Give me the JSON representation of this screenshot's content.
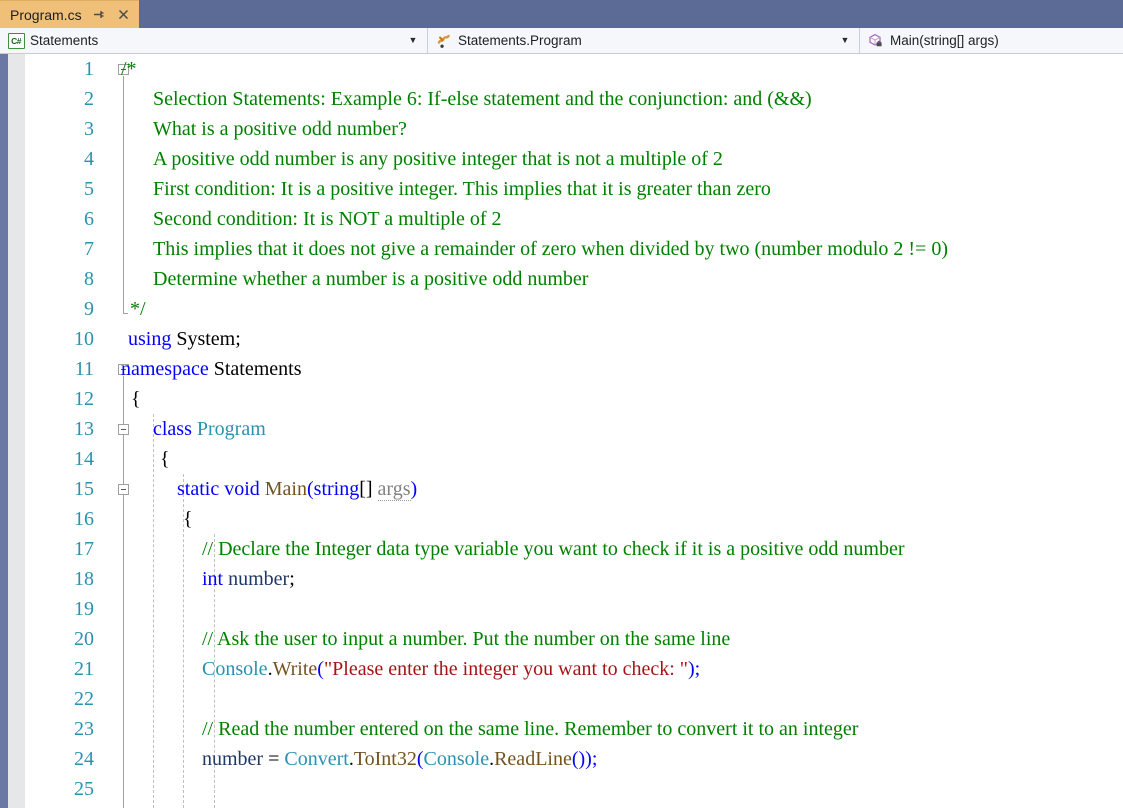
{
  "window": {
    "tab": {
      "title": "Program.cs",
      "pin_icon": "pin-icon",
      "close_icon": "close-icon"
    }
  },
  "navbar": {
    "project_combo": {
      "icon": "csharp-project-icon",
      "value": "Statements",
      "arrow": "chevron-down-icon"
    },
    "type_combo": {
      "icon": "class-icon",
      "value": "Statements.Program",
      "arrow": "chevron-down-icon"
    },
    "member_combo": {
      "icon": "method-private-icon",
      "value": "Main(string[] args)",
      "arrow": ""
    }
  },
  "editor": {
    "first_line": 1,
    "last_line": 25,
    "line_numbers": [
      1,
      2,
      3,
      4,
      5,
      6,
      7,
      8,
      9,
      10,
      11,
      12,
      13,
      14,
      15,
      16,
      17,
      18,
      19,
      20,
      21,
      22,
      23,
      24,
      25
    ],
    "colors": {
      "comment": "#008000",
      "keyword": "#0000ff",
      "type": "#2b91af",
      "method": "#74531f",
      "string": "#a31515",
      "plain_identifier": "#1f3864",
      "unused_param": "#808080",
      "line_number": "#2b91af",
      "tab_background": "#f0c079",
      "titlebar_background": "#5c6a96",
      "left_strip": "#6b78a3",
      "track_margin": "#e6e7e8",
      "navbar_background": "#eef1f8"
    },
    "lines": [
      {
        "n": 1,
        "text": "/*"
      },
      {
        "n": 2,
        "text": "    Selection Statements: Example 6: If-else statement and the conjunction: and (&&)"
      },
      {
        "n": 3,
        "text": "    What is a positive odd number?"
      },
      {
        "n": 4,
        "text": "    A positive odd number is any positive integer that is not a multiple of 2"
      },
      {
        "n": 5,
        "text": "    First condition: It is a positive integer. This implies that it is greater than zero"
      },
      {
        "n": 6,
        "text": "    Second condition: It is NOT a multiple of 2"
      },
      {
        "n": 7,
        "text": "    This implies that it does not give a remainder of zero when divided by two (number modulo 2 != 0)"
      },
      {
        "n": 8,
        "text": "    Determine whether a number is a positive odd number"
      },
      {
        "n": 9,
        "text": " */"
      },
      {
        "n": 10,
        "text": "using System;"
      },
      {
        "n": 11,
        "text": "namespace Statements"
      },
      {
        "n": 12,
        "text": "{"
      },
      {
        "n": 13,
        "text": "    class Program"
      },
      {
        "n": 14,
        "text": "    {"
      },
      {
        "n": 15,
        "text": "        static void Main(string[] args)"
      },
      {
        "n": 16,
        "text": "        {"
      },
      {
        "n": 17,
        "text": "            // Declare the Integer data type variable you want to check if it is a positive odd number"
      },
      {
        "n": 18,
        "text": "            int number;"
      },
      {
        "n": 19,
        "text": ""
      },
      {
        "n": 20,
        "text": "            // Ask the user to input a number. Put the number on the same line"
      },
      {
        "n": 21,
        "text": "            Console.Write(\"Please enter the integer you want to check: \");"
      },
      {
        "n": 22,
        "text": ""
      },
      {
        "n": 23,
        "text": "            // Read the number entered on the same line. Remember to convert it to an integer"
      },
      {
        "n": 24,
        "text": "            number = Convert.ToInt32(Console.ReadLine());"
      },
      {
        "n": 25,
        "text": ""
      }
    ],
    "tokens": {
      "l1_comment": "/*",
      "l2_comment": "Selection Statements: Example 6: If-else statement and the conjunction: and (&&)",
      "l3_comment": "What is a positive odd number?",
      "l4_comment": "A positive odd number is any positive integer that is not a multiple of 2",
      "l5_comment": "First condition: It is a positive integer. This implies that it is greater than zero",
      "l6_comment": "Second condition: It is NOT a multiple of 2",
      "l7_comment": "This implies that it does not give a remainder of zero when divided by two (number modulo 2 != 0)",
      "l8_comment": "Determine whether a number is a positive odd number",
      "l9_comment": "*/",
      "l10_kw": "using",
      "l10_rest": " System;",
      "l11_kw": "namespace",
      "l11_rest": " Statements",
      "l12_brace": "{",
      "l13_kw": "class",
      "l13_type": " Program",
      "l14_brace": "{",
      "l15_kw": "static void",
      "l15_method": " Main",
      "l15_open": "(",
      "l15_kw2": "string",
      "l15_brackets": "[] ",
      "l15_param": "args",
      "l15_close": ")",
      "l16_brace": "{",
      "l17_comment": "// Declare the Integer data type variable you want to check if it is a positive odd number",
      "l18_kw": "int",
      "l18_ident": " number",
      "l18_semi": ";",
      "l20_comment": "// Ask the user to input a number. Put the number on the same line",
      "l21_type": "Console",
      "l21_dot": ".",
      "l21_method": "Write",
      "l21_open": "(",
      "l21_string": "\"Please enter the integer you want to check: \"",
      "l21_close": ");",
      "l23_comment": "// Read the number entered on the same line. Remember to convert it to an integer",
      "l24_ident": "number",
      "l24_eq": " = ",
      "l24_type1": "Convert",
      "l24_dot1": ".",
      "l24_method1": "ToInt32",
      "l24_open1": "(",
      "l24_type2": "Console",
      "l24_dot2": ".",
      "l24_method2": "ReadLine",
      "l24_close": "());"
    }
  }
}
